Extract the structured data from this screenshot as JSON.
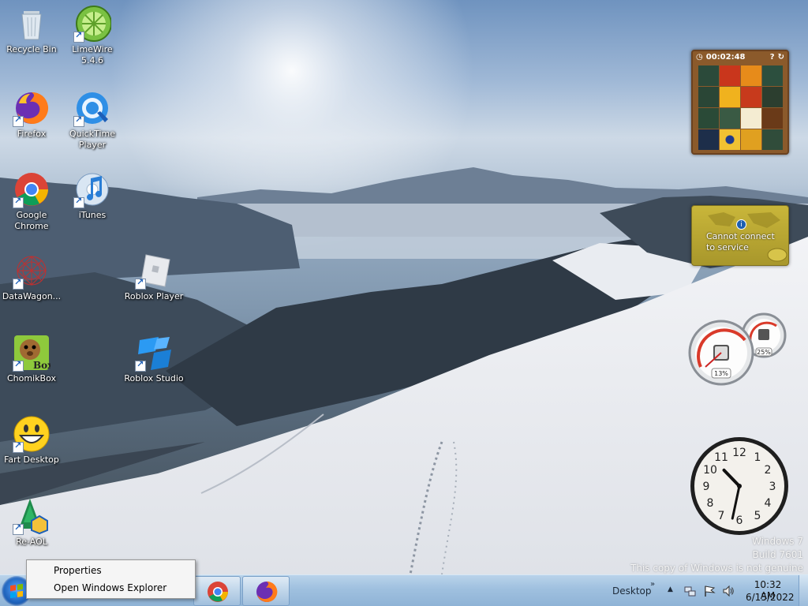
{
  "desktop_icons": [
    {
      "label": "Recycle Bin",
      "icon": "recycle-bin-icon"
    },
    {
      "label": "LimeWire 5.4.6",
      "icon": "limewire-icon"
    },
    {
      "label": "Firefox",
      "icon": "firefox-icon"
    },
    {
      "label": "QuickTime Player",
      "icon": "quicktime-icon"
    },
    {
      "label": "Google Chrome",
      "icon": "chrome-icon"
    },
    {
      "label": "iTunes",
      "icon": "itunes-icon"
    },
    {
      "label": "DataWagon...",
      "icon": "datawagon-icon"
    },
    {
      "label": "Roblox Player",
      "icon": "roblox-player-icon"
    },
    {
      "label": "ChomikBox",
      "icon": "chomikbox-icon"
    },
    {
      "label": "Roblox Studio",
      "icon": "roblox-studio-icon"
    },
    {
      "label": "Fart Desktop",
      "icon": "smiley-icon"
    },
    {
      "label": "Re-AOL",
      "icon": "aol-icon"
    }
  ],
  "gadgets": {
    "puzzle": {
      "timer": "00:02:48"
    },
    "weather": {
      "message_line1": "Cannot connect",
      "message_line2": "to service"
    },
    "cpu_meter": {
      "cpu": "13%",
      "memory": "25%"
    },
    "clock": {
      "hour": 10,
      "minute": 32
    }
  },
  "watermark": {
    "line1": "Windows 7",
    "line2": "Build 7601",
    "line3": "This copy of Windows is not genuine"
  },
  "context_menu": {
    "items": [
      "Properties",
      "Open Windows Explorer"
    ]
  },
  "taskbar": {
    "pinned": [
      {
        "name": "Google Chrome",
        "icon": "chrome-icon"
      },
      {
        "name": "Firefox",
        "icon": "firefox-icon"
      }
    ],
    "toolbar_label": "Desktop",
    "toolbar_chevron": "»",
    "clock_time": "10:32 AM",
    "clock_date": "6/15/2022"
  },
  "colors": {
    "taskbar": "#9fc0df",
    "start_orb": "#1b5fb8",
    "weather_gadget": "#b8a632",
    "puzzle_frame": "#8b5a2b"
  }
}
